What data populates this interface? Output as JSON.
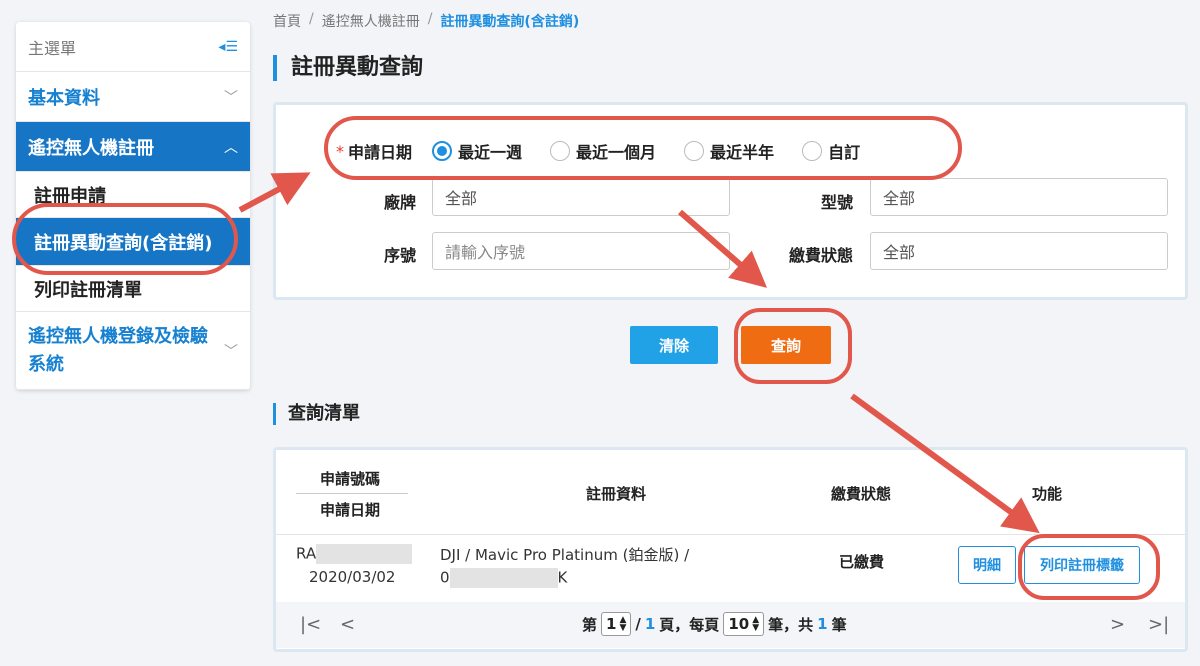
{
  "sidebar": {
    "header": "主選單",
    "toggle_icon": "menu-collapse-icon",
    "items": [
      {
        "label": "基本資料"
      },
      {
        "label": "遙控無人機註冊",
        "subitems": [
          "註冊申請",
          "註冊異動查詢(含註銷)",
          "列印註冊清單"
        ]
      },
      {
        "label": "遙控無人機登錄及檢驗系統"
      }
    ]
  },
  "breadcrumb": [
    "首頁",
    "遙控無人機註冊",
    "註冊異動查詢(含註銷)"
  ],
  "page_title": "註冊異動查詢",
  "form": {
    "date_label": "申請日期",
    "date_options": [
      "最近一週",
      "最近一個月",
      "最近半年",
      "自訂"
    ],
    "brand_label": "廠牌",
    "brand_value": "全部",
    "model_label": "型號",
    "model_value": "全部",
    "serial_label": "序號",
    "serial_placeholder": "請輸入序號",
    "payment_label": "繳費狀態",
    "payment_value": "全部"
  },
  "buttons": {
    "clear": "清除",
    "query": "查詢"
  },
  "list_title": "查詢清單",
  "table": {
    "headers": {
      "app_no": "申請號碼",
      "app_date": "申請日期",
      "reg_info": "註冊資料",
      "payment": "繳費狀態",
      "actions": "功能"
    },
    "rows": [
      {
        "app_no_prefix": "RA",
        "app_date": "2020/03/02",
        "reg_info_line1": "DJI / Mavic Pro Platinum (鉑金版) /",
        "reg_info_prefix": "0",
        "reg_info_suffix": "K",
        "payment": "已繳費",
        "detail_btn": "明細",
        "print_btn": "列印註冊標籤"
      }
    ]
  },
  "pager": {
    "prefix": "第",
    "page": "1",
    "slash": "/",
    "total_pages": "1",
    "page_suffix": "頁，每頁",
    "per_page": "10",
    "per_page_suffix": "筆，共",
    "total": "1",
    "total_suffix": "筆"
  },
  "colors": {
    "primary": "#1f8fe0",
    "sidebar_active": "#1676c5",
    "query_button": "#ef6c12",
    "annotation": "#e2574c"
  }
}
